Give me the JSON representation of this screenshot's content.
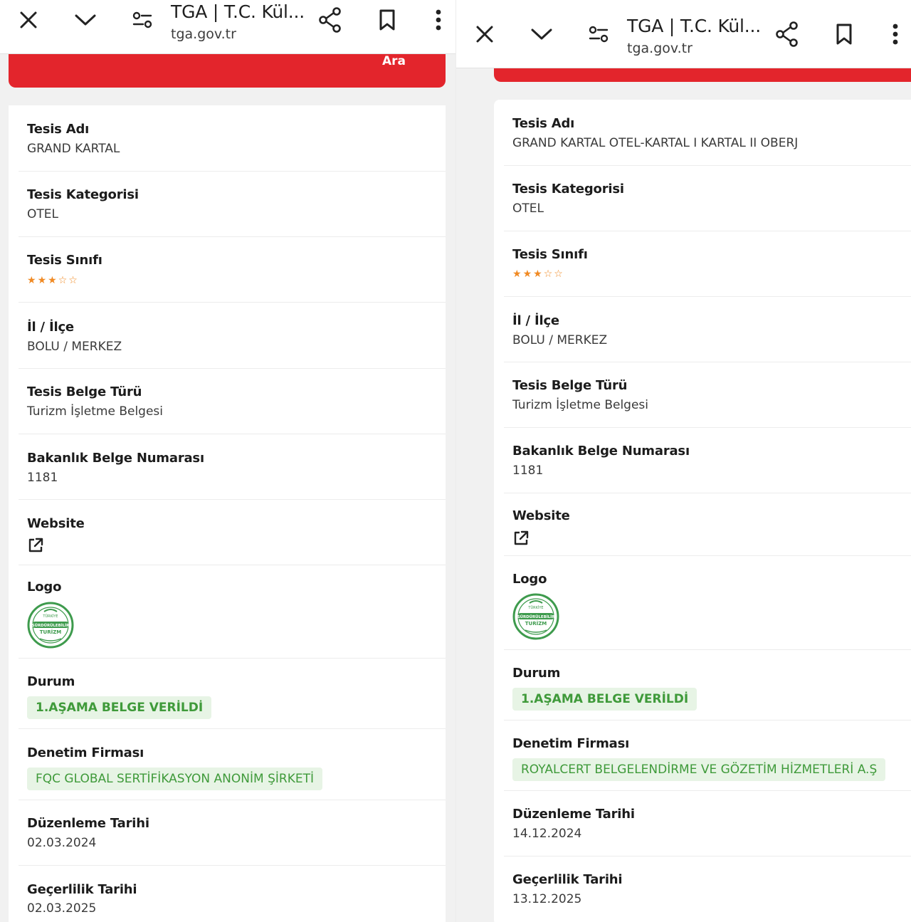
{
  "colors": {
    "accent_red": "#e3252c",
    "badge_bg": "#e7f4e5",
    "badge_text": "#3f9a3a",
    "star": "#f08a24"
  },
  "icons": {
    "close": "close-icon",
    "collapse": "chevron-down-icon",
    "page_settings": "tune-icon",
    "share": "share-icon",
    "bookmark": "bookmark-icon",
    "menu": "more-vertical-icon",
    "external_link": "external-link-icon",
    "logo": "sustainable-tourism-logo"
  },
  "panels": [
    {
      "browser": {
        "title": "TGA | T.C. Kül...",
        "url": "tga.gov.tr"
      },
      "search_button_label": "Ara",
      "fields": {
        "name_label": "Tesis Adı",
        "name_value": "GRAND KARTAL",
        "category_label": "Tesis Kategorisi",
        "category_value": "OTEL",
        "class_label": "Tesis Sınıfı",
        "class_rating": 3,
        "class_max": 5,
        "location_label": "İl / İlçe",
        "location_value": "BOLU / MERKEZ",
        "doc_type_label": "Tesis Belge Türü",
        "doc_type_value": "Turizm İşletme Belgesi",
        "doc_number_label": "Bakanlık Belge Numarası",
        "doc_number_value": "1181",
        "website_label": "Website",
        "logo_label": "Logo",
        "logo_text_top": "TÜRKİYE",
        "logo_text_mid": "SÜRDÜRÜLEBİLİR",
        "logo_text_bottom": "TURİZM",
        "status_label": "Durum",
        "status_value": "1.AŞAMA BELGE VERİLDİ",
        "auditor_label": "Denetim Firması",
        "auditor_value": "FQC GLOBAL SERTİFİKASYON ANONİM ŞİRKETİ",
        "issue_date_label": "Düzenleme Tarihi",
        "issue_date_value": "02.03.2024",
        "valid_date_label": "Geçerlilik Tarihi",
        "valid_date_value": "02.03.2025"
      }
    },
    {
      "browser": {
        "title": "TGA | T.C. Kül...",
        "url": "tga.gov.tr"
      },
      "fields": {
        "name_label": "Tesis Adı",
        "name_value": "GRAND KARTAL OTEL-KARTAL I KARTAL II OBERJ",
        "category_label": "Tesis Kategorisi",
        "category_value": "OTEL",
        "class_label": "Tesis Sınıfı",
        "class_rating": 3,
        "class_max": 5,
        "location_label": "İl / İlçe",
        "location_value": "BOLU / MERKEZ",
        "doc_type_label": "Tesis Belge Türü",
        "doc_type_value": "Turizm İşletme Belgesi",
        "doc_number_label": "Bakanlık Belge Numarası",
        "doc_number_value": "1181",
        "website_label": "Website",
        "logo_label": "Logo",
        "logo_text_top": "TÜRKİYE",
        "logo_text_mid": "SÜRDÜRÜLEBİLİR",
        "logo_text_bottom": "TURİZM",
        "status_label": "Durum",
        "status_value": "1.AŞAMA BELGE VERİLDİ",
        "auditor_label": "Denetim Firması",
        "auditor_value": "ROYALCERT BELGELENDİRME VE GÖZETİM HİZMETLERİ A.Ş",
        "issue_date_label": "Düzenleme Tarihi",
        "issue_date_value": "14.12.2024",
        "valid_date_label": "Geçerlilik Tarihi",
        "valid_date_value": "13.12.2025"
      }
    }
  ]
}
